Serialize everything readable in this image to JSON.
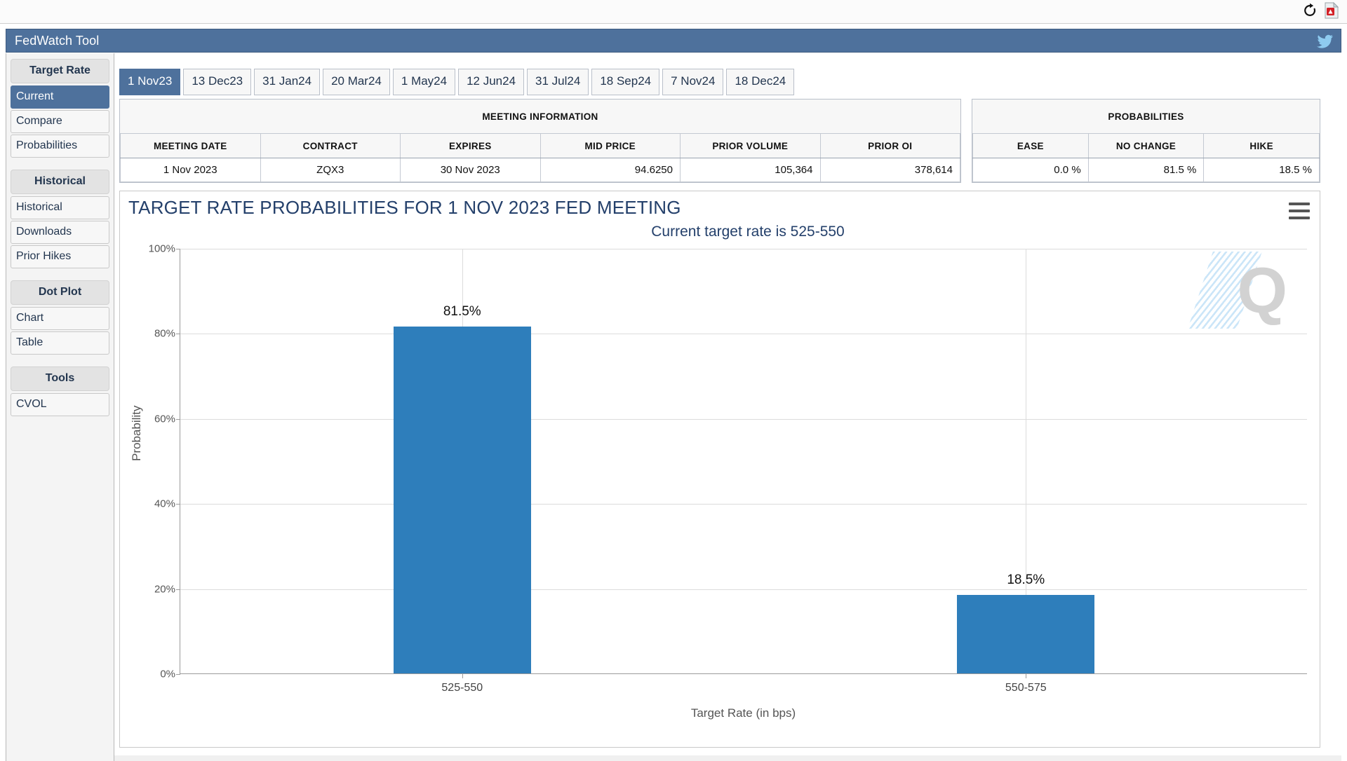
{
  "browser": {
    "icons": [
      "refresh-icon",
      "pdf-icon"
    ]
  },
  "app": {
    "title": "FedWatch Tool",
    "social_icon": "twitter-icon"
  },
  "sidebar": {
    "groups": [
      {
        "label": "Target Rate",
        "items": [
          {
            "label": "Current",
            "active": true
          },
          {
            "label": "Compare",
            "active": false
          },
          {
            "label": "Probabilities",
            "active": false
          }
        ]
      },
      {
        "label": "Historical",
        "items": [
          {
            "label": "Historical",
            "active": false
          },
          {
            "label": "Downloads",
            "active": false
          },
          {
            "label": "Prior Hikes",
            "active": false
          }
        ]
      },
      {
        "label": "Dot Plot",
        "items": [
          {
            "label": "Chart",
            "active": false
          },
          {
            "label": "Table",
            "active": false
          }
        ]
      },
      {
        "label": "Tools",
        "items": [
          {
            "label": "CVOL",
            "active": false
          }
        ]
      }
    ]
  },
  "tabs": [
    {
      "label": "1 Nov23",
      "active": true
    },
    {
      "label": "13 Dec23",
      "active": false
    },
    {
      "label": "31 Jan24",
      "active": false
    },
    {
      "label": "20 Mar24",
      "active": false
    },
    {
      "label": "1 May24",
      "active": false
    },
    {
      "label": "12 Jun24",
      "active": false
    },
    {
      "label": "31 Jul24",
      "active": false
    },
    {
      "label": "18 Sep24",
      "active": false
    },
    {
      "label": "7 Nov24",
      "active": false
    },
    {
      "label": "18 Dec24",
      "active": false
    }
  ],
  "meeting_information": {
    "caption": "MEETING INFORMATION",
    "columns": [
      "MEETING DATE",
      "CONTRACT",
      "EXPIRES",
      "MID PRICE",
      "PRIOR VOLUME",
      "PRIOR OI"
    ],
    "row": {
      "meeting_date": "1 Nov 2023",
      "contract": "ZQX3",
      "expires": "30 Nov 2023",
      "mid_price": "94.6250",
      "prior_volume": "105,364",
      "prior_oi": "378,614"
    }
  },
  "probabilities_table": {
    "caption": "PROBABILITIES",
    "columns": [
      "EASE",
      "NO CHANGE",
      "HIKE"
    ],
    "row": {
      "ease": "0.0 %",
      "no_change": "81.5 %",
      "hike": "18.5 %"
    }
  },
  "chart_header": {
    "title": "TARGET RATE PROBABILITIES FOR 1 NOV 2023 FED MEETING",
    "subtitle": "Current target rate is 525-550",
    "menu_icon": "hamburger-menu-icon",
    "watermark": "Q"
  },
  "chart_data": {
    "type": "bar",
    "title": "TARGET RATE PROBABILITIES FOR 1 NOV 2023 FED MEETING",
    "subtitle": "Current target rate is 525-550",
    "categories": [
      "525-550",
      "550-575"
    ],
    "values": [
      81.5,
      18.5
    ],
    "data_labels": [
      "81.5%",
      "18.5%"
    ],
    "xlabel": "Target Rate (in bps)",
    "ylabel": "Probability",
    "ylim": [
      0,
      100
    ],
    "yticks": [
      "0%",
      "20%",
      "40%",
      "60%",
      "80%",
      "100%"
    ],
    "ytick_values": [
      0,
      20,
      40,
      60,
      80,
      100
    ],
    "grid": true,
    "legend": "none",
    "bar_color": "#2e7ebb"
  }
}
